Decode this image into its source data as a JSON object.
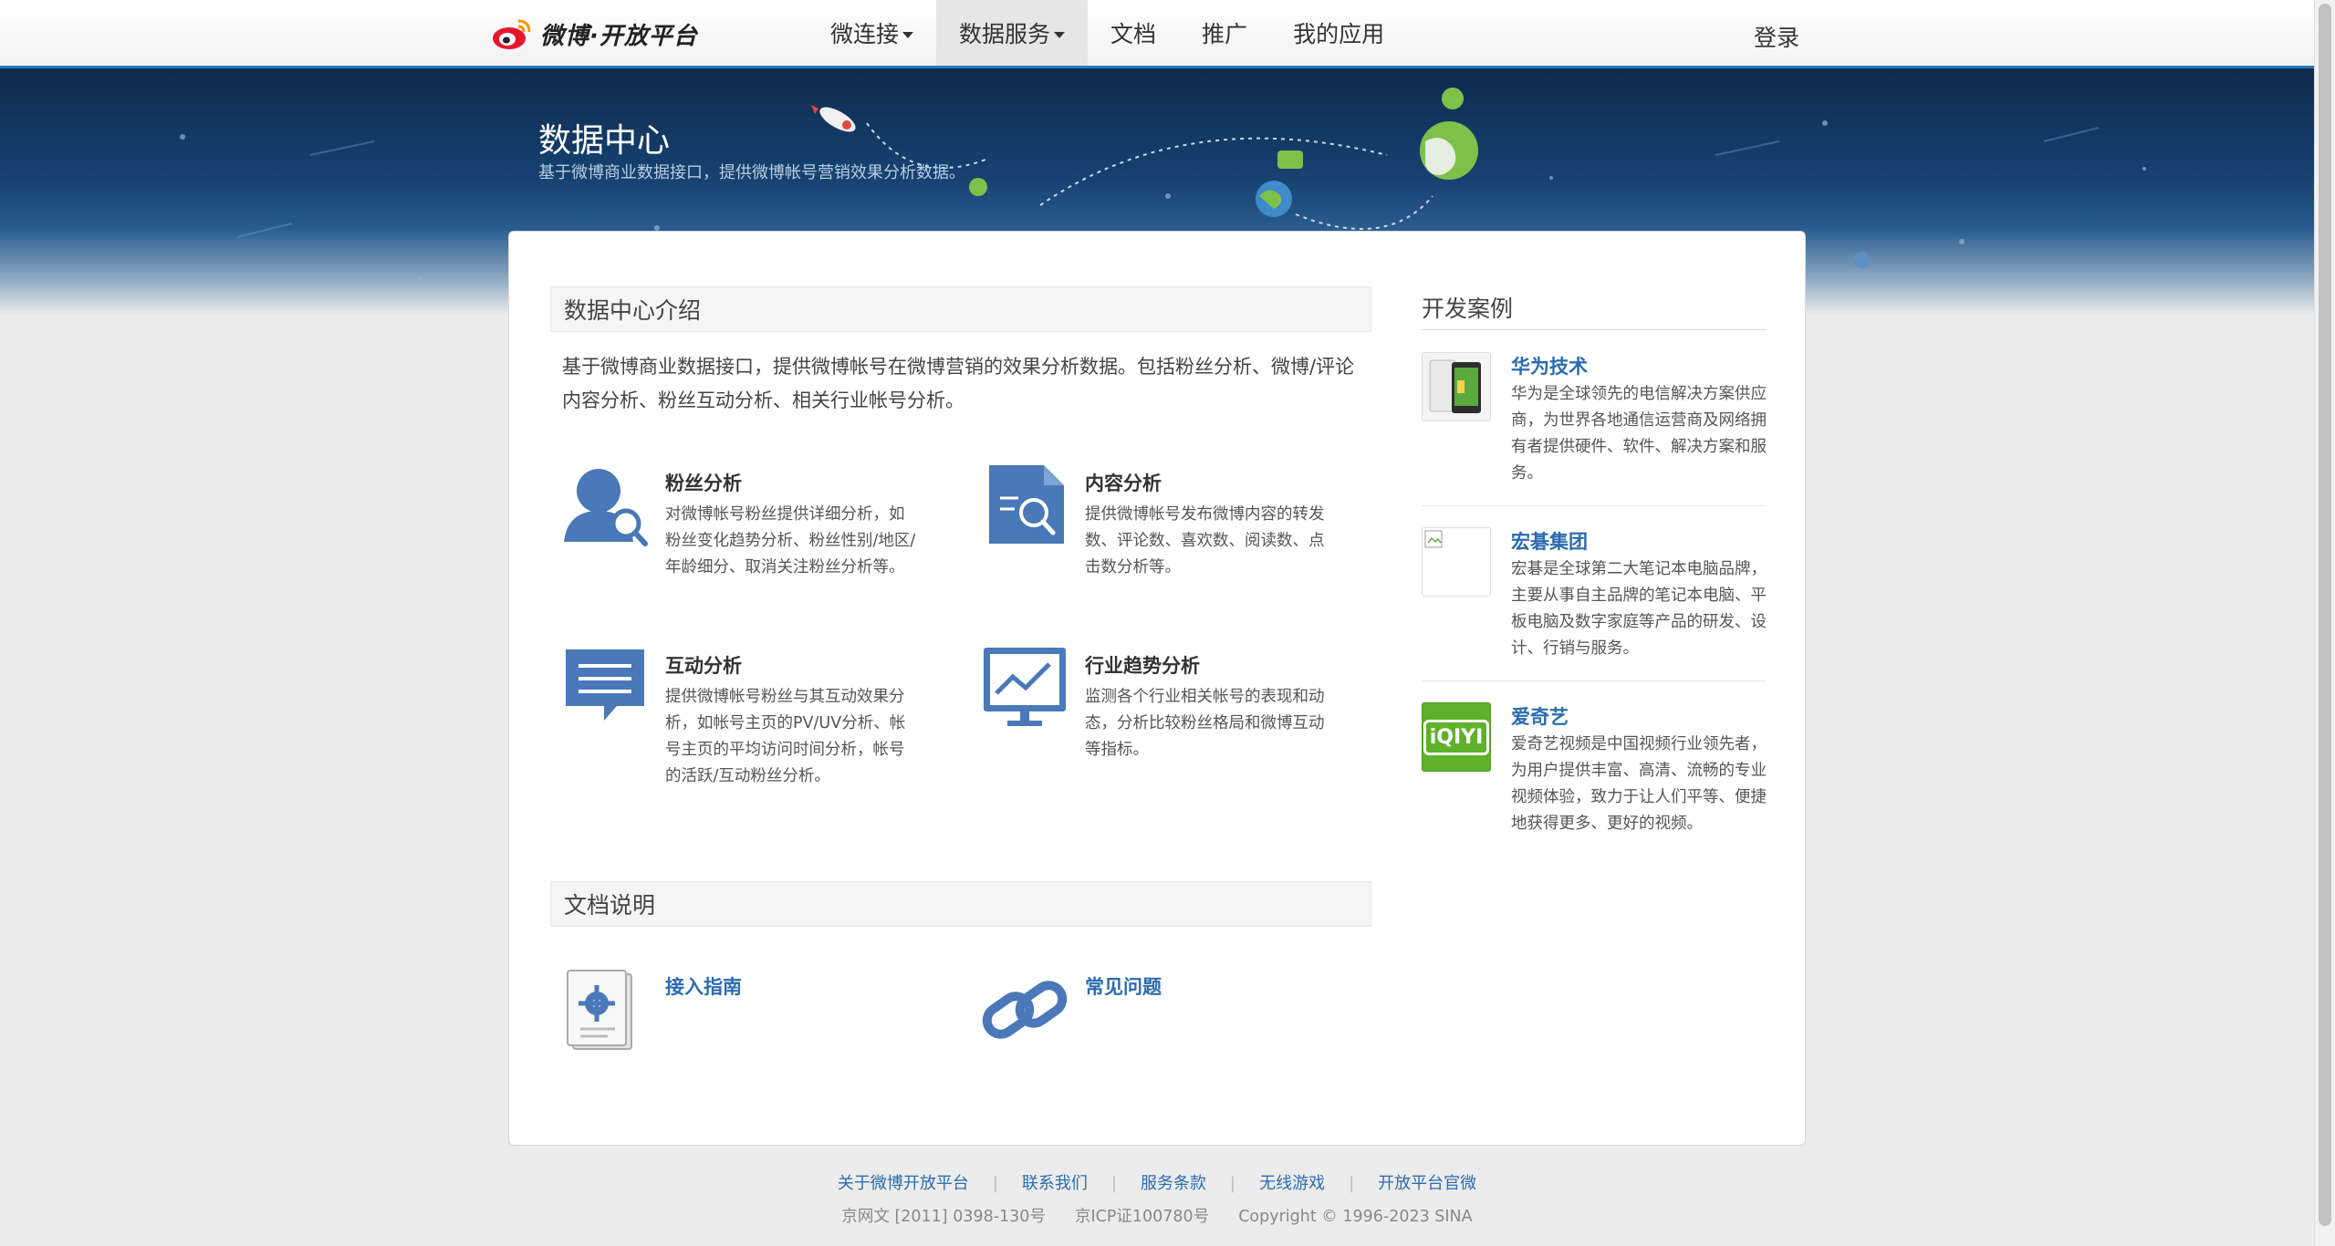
{
  "header": {
    "logo_text": "微博·开放平台",
    "nav": [
      {
        "label": "微连接",
        "dropdown": true
      },
      {
        "label": "数据服务",
        "dropdown": true,
        "active": true
      },
      {
        "label": "文档",
        "dropdown": false
      },
      {
        "label": "推广",
        "dropdown": false
      },
      {
        "label": "我的应用",
        "dropdown": false
      }
    ],
    "login_label": "登录"
  },
  "banner": {
    "title": "数据中心",
    "subtitle": "基于微博商业数据接口，提供微博帐号营销效果分析数据。"
  },
  "intro_section": {
    "heading": "数据中心介绍",
    "text": "基于微博商业数据接口，提供微博帐号在微博营销的效果分析数据。包括粉丝分析、微博/评论内容分析、粉丝互动分析、相关行业帐号分析。"
  },
  "features": [
    {
      "title": "粉丝分析",
      "desc": "对微博帐号粉丝提供详细分析，如粉丝变化趋势分析、粉丝性别/地区/年龄细分、取消关注粉丝分析等。",
      "icon": "user-search-icon"
    },
    {
      "title": "内容分析",
      "desc": "提供微博帐号发布微博内容的转发数、评论数、喜欢数、阅读数、点击数分析等。",
      "icon": "document-search-icon"
    },
    {
      "title": "互动分析",
      "desc": "提供微博帐号粉丝与其互动效果分析，如帐号主页的PV/UV分析、帐号主页的平均访问时间分析，帐号的活跃/互动粉丝分析。",
      "icon": "chat-bubble-icon"
    },
    {
      "title": "行业趋势分析",
      "desc": "监测各个行业相关帐号的表现和动态，分析比较粉丝格局和微博互动等指标。",
      "icon": "trend-monitor-icon"
    }
  ],
  "docs_section": {
    "heading": "文档说明",
    "links": [
      {
        "label": "接入指南",
        "icon": "gear-document-icon"
      },
      {
        "label": "常见问题",
        "icon": "chain-link-icon"
      }
    ]
  },
  "cases": {
    "title": "开发案例",
    "items": [
      {
        "name": "华为技术",
        "desc": "华为是全球领先的电信解决方案供应商，为世界各地通信运营商及网络拥有者提供硬件、软件、解决方案和服务。",
        "thumb": "huawei-phone-thumb"
      },
      {
        "name": "宏碁集团",
        "desc": "宏碁是全球第二大笔记本电脑品牌，主要从事自主品牌的笔记本电脑、平板电脑及数字家庭等产品的研发、设计、行销与服务。",
        "thumb": "broken-image-thumb"
      },
      {
        "name": "爱奇艺",
        "desc": "爱奇艺视频是中国视频行业领先者，为用户提供丰富、高清、流畅的专业视频体验，致力于让人们平等、便捷地获得更多、更好的视频。",
        "thumb": "iqiyi-logo-thumb",
        "thumb_text": "iQIYI"
      }
    ]
  },
  "footer": {
    "links": [
      "关于微博开放平台",
      "联系我们",
      "服务条款",
      "无线游戏",
      "开放平台官微"
    ],
    "separator": "|",
    "copyright": [
      "京网文 [2011] 0398-130号",
      "京ICP证100780号",
      "Copyright © 1996-2023 SINA"
    ]
  },
  "colors": {
    "accent": "#2b6cb0",
    "nav_border": "#2b78c0",
    "icon_blue": "#4a78b8",
    "banner_dark": "#0f2b4e"
  }
}
